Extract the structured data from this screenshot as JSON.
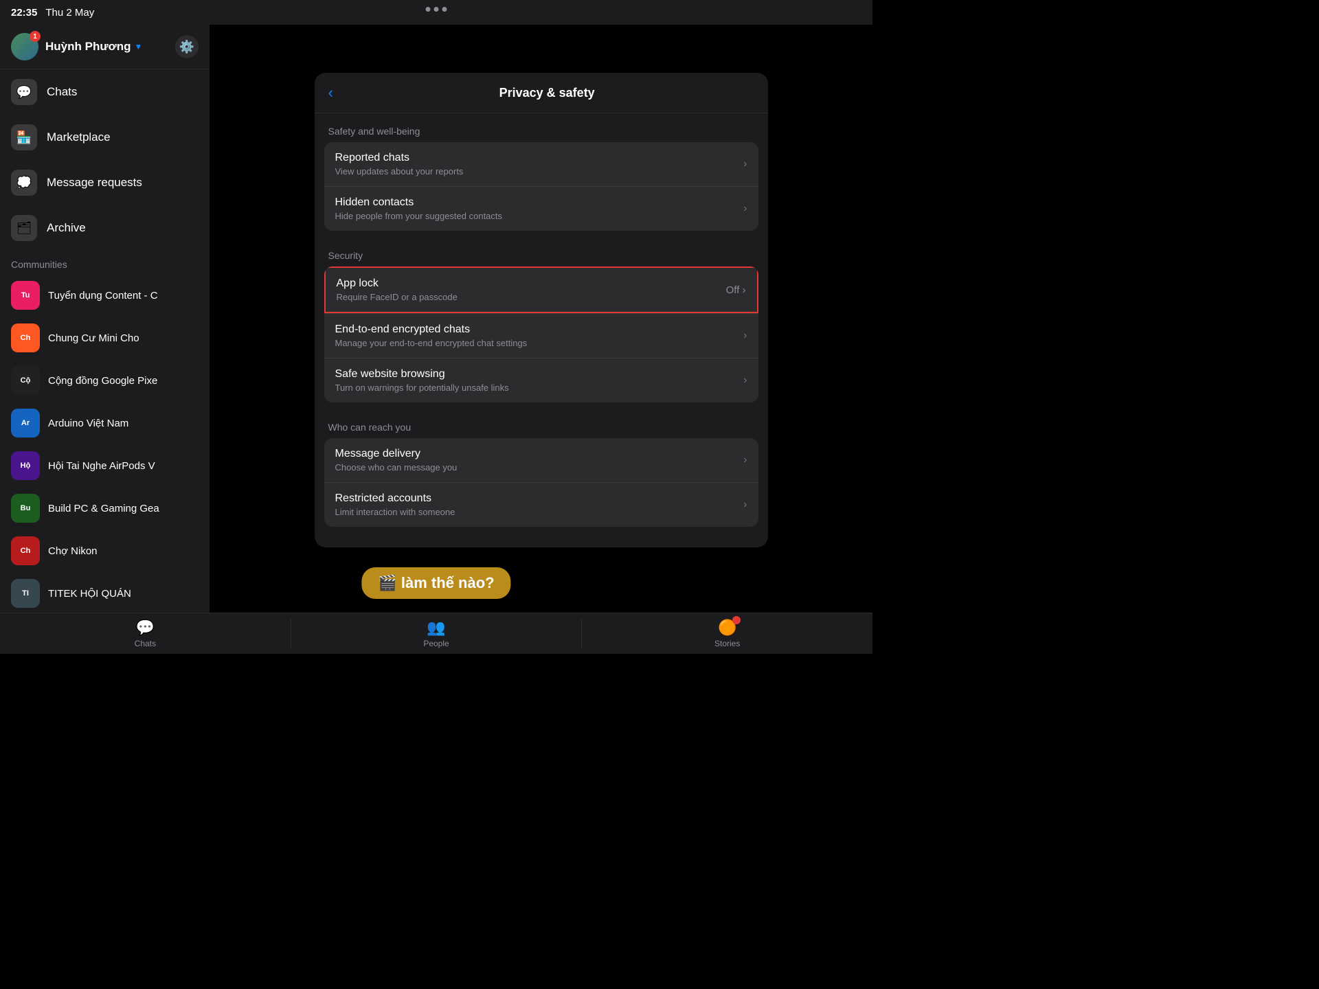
{
  "statusBar": {
    "time": "22:35",
    "date": "Thu 2 May"
  },
  "sidebar": {
    "user": {
      "name": "Huỳnh Phương",
      "badge": "1"
    },
    "navItems": [
      {
        "id": "chats",
        "icon": "💬",
        "label": "Chats"
      },
      {
        "id": "marketplace",
        "icon": "🏪",
        "label": "Marketplace"
      },
      {
        "id": "message-requests",
        "icon": "💭",
        "label": "Message requests"
      },
      {
        "id": "archive",
        "icon": "🗂",
        "label": "Archive"
      }
    ],
    "communitiesLabel": "Communities",
    "communities": [
      {
        "id": "1",
        "name": "Tuyển dụng Content - C",
        "bg": "#e91e63"
      },
      {
        "id": "2",
        "name": "Chung Cư Mini Cho",
        "bg": "#ff5722"
      },
      {
        "id": "3",
        "name": "Cộng đồng Google Pixe",
        "bg": "#212121"
      },
      {
        "id": "4",
        "name": "Arduino Việt Nam",
        "bg": "#1565c0"
      },
      {
        "id": "5",
        "name": "Hội Tai Nghe AirPods V",
        "bg": "#4a148c"
      },
      {
        "id": "6",
        "name": "Build PC & Gaming Gea",
        "bg": "#1b5e20"
      },
      {
        "id": "7",
        "name": "Chợ Nikon",
        "bg": "#b71c1c"
      },
      {
        "id": "8",
        "name": "TITEK HỘI QUÁN",
        "bg": "#37474f"
      }
    ]
  },
  "sheet": {
    "title": "Privacy & safety",
    "backLabel": "‹",
    "sections": [
      {
        "header": "Safety and well-being",
        "items": [
          {
            "id": "reported-chats",
            "title": "Reported chats",
            "subtitle": "View updates about your reports",
            "rightValue": "",
            "hasChevron": true
          },
          {
            "id": "hidden-contacts",
            "title": "Hidden contacts",
            "subtitle": "Hide people from your suggested contacts",
            "rightValue": "",
            "hasChevron": true
          }
        ]
      },
      {
        "header": "Security",
        "items": [
          {
            "id": "app-lock",
            "title": "App lock",
            "subtitle": "Require FaceID or a passcode",
            "rightValue": "Off",
            "hasChevron": true,
            "highlighted": true
          },
          {
            "id": "e2e-chats",
            "title": "End-to-end encrypted chats",
            "subtitle": "Manage your end-to-end encrypted chat settings",
            "rightValue": "",
            "hasChevron": true
          },
          {
            "id": "safe-browsing",
            "title": "Safe website browsing",
            "subtitle": "Turn on warnings for potentially unsafe links",
            "rightValue": "",
            "hasChevron": true
          }
        ]
      },
      {
        "header": "Who can reach you",
        "items": [
          {
            "id": "message-delivery",
            "title": "Message delivery",
            "subtitle": "Choose who can message you",
            "rightValue": "",
            "hasChevron": true
          },
          {
            "id": "restricted-accounts",
            "title": "Restricted accounts",
            "subtitle": "Limit interaction with someone",
            "rightValue": "",
            "hasChevron": true
          }
        ]
      }
    ]
  },
  "bottomBar": {
    "tabs": [
      {
        "id": "people",
        "icon": "👥",
        "label": "People"
      },
      {
        "id": "stories",
        "icon": "🟠",
        "label": "Stories",
        "hasBadge": true
      }
    ]
  },
  "watermark": {
    "text": "🎬 làm thế nào?"
  }
}
